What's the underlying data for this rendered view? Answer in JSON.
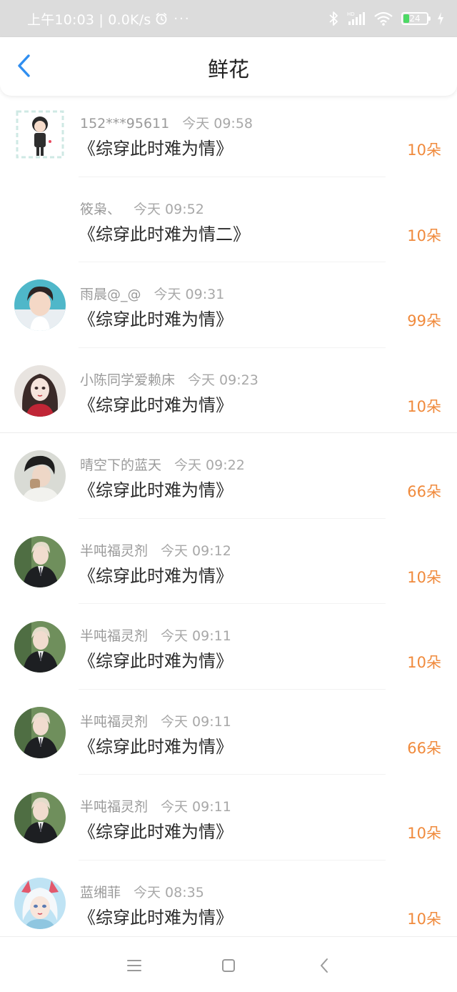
{
  "status_bar": {
    "time_info": "上午10:03 | 0.0K/s",
    "dots": "···",
    "battery": "24",
    "battery_fraction": 0.24
  },
  "header": {
    "title": "鲜花"
  },
  "items": [
    {
      "user": "152***95611",
      "time": "今天 09:58",
      "book": "《综穿此时难为情》",
      "count": "10朵"
    },
    {
      "user": "筱枭、",
      "time": "今天 09:52",
      "book": "《综穿此时难为情二》",
      "count": "10朵"
    },
    {
      "user": "雨晨@_@",
      "time": "今天 09:31",
      "book": "《综穿此时难为情》",
      "count": "99朵"
    },
    {
      "user": "小陈同学爱赖床",
      "time": "今天 09:23",
      "book": "《综穿此时难为情》",
      "count": "10朵"
    },
    {
      "user": "晴空下的蓝天",
      "time": "今天 09:22",
      "book": "《综穿此时难为情》",
      "count": "66朵"
    },
    {
      "user": "半吨福灵剂",
      "time": "今天 09:12",
      "book": "《综穿此时难为情》",
      "count": "10朵"
    },
    {
      "user": "半吨福灵剂",
      "time": "今天 09:11",
      "book": "《综穿此时难为情》",
      "count": "10朵"
    },
    {
      "user": "半吨福灵剂",
      "time": "今天 09:11",
      "book": "《综穿此时难为情》",
      "count": "66朵"
    },
    {
      "user": "半吨福灵剂",
      "time": "今天 09:11",
      "book": "《综穿此时难为情》",
      "count": "10朵"
    },
    {
      "user": "蓝缃菲",
      "time": "今天 08:35",
      "book": "《综穿此时难为情》",
      "count": "10朵"
    }
  ],
  "colors": {
    "accent": "#2f8ef0",
    "count": "#f08a3c",
    "status_bar_bg": "#dcdcdc"
  },
  "nav": {
    "menu_icon": "menu-icon",
    "home_icon": "home-icon",
    "back_icon": "back-icon"
  }
}
